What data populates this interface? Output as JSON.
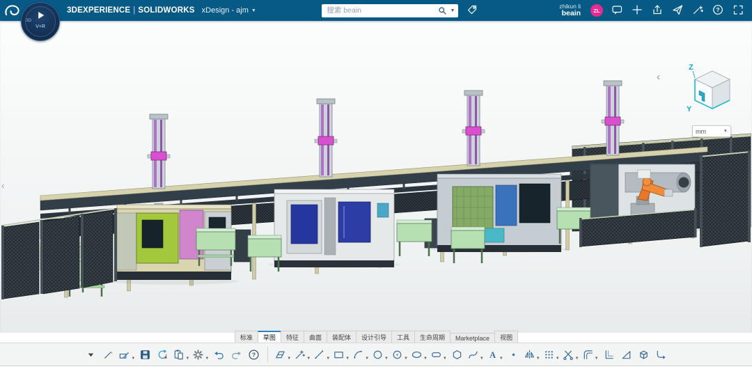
{
  "top_bar": {
    "brand": "3DEXPERIENCE",
    "divider": "|",
    "product": "SOLIDWORKS",
    "app_label": "xDesign - ajm",
    "search": {
      "placeholder": "搜索 beain"
    },
    "user": {
      "name": "zhikun li",
      "space": "beain",
      "avatar": "ZL"
    },
    "icons": [
      "assistant",
      "add",
      "share",
      "send",
      "actions",
      "help",
      "fullscreen"
    ]
  },
  "compass": {
    "quadrant_label": "3D",
    "center_label": "V+R"
  },
  "viewport": {
    "unit_label": "mm",
    "cube_axis_z": "Z",
    "cube_axis_y": "Y"
  },
  "tabs": [
    {
      "label": "标准",
      "active": false
    },
    {
      "label": "草图",
      "active": true
    },
    {
      "label": "特征",
      "active": false
    },
    {
      "label": "曲面",
      "active": false
    },
    {
      "label": "装配体",
      "active": false
    },
    {
      "label": "设计引导",
      "active": false
    },
    {
      "label": "工具",
      "active": false
    },
    {
      "label": "生命周期",
      "active": false
    },
    {
      "label": "Marketplace",
      "active": false
    },
    {
      "label": "视图",
      "active": false
    }
  ],
  "toolbar": {
    "groups": [
      {
        "name": "standard",
        "items": [
          {
            "icon": "caret",
            "name": "overflow-caret",
            "caret": false
          },
          {
            "icon": "sketch",
            "name": "new-sketch",
            "caret": false
          },
          {
            "icon": "sketch-edit",
            "name": "edit-sketch",
            "caret": true
          },
          {
            "icon": "save",
            "name": "save",
            "caret": false
          },
          {
            "icon": "sync",
            "name": "update",
            "caret": false
          },
          {
            "icon": "paste",
            "name": "paste",
            "caret": true
          },
          {
            "icon": "gear",
            "name": "settings",
            "caret": true
          },
          {
            "icon": "undo",
            "name": "undo",
            "caret": false
          },
          {
            "icon": "redo",
            "name": "redo",
            "caret": false
          },
          {
            "icon": "help",
            "name": "help",
            "caret": false
          }
        ]
      },
      {
        "name": "sketch",
        "items": [
          {
            "icon": "plane",
            "name": "sketch-plane",
            "caret": true
          },
          {
            "icon": "instant",
            "name": "instant-sketch",
            "caret": true
          },
          {
            "icon": "line",
            "name": "line-tool",
            "caret": true
          },
          {
            "icon": "rect",
            "name": "rectangle-tool",
            "caret": true
          },
          {
            "icon": "arc",
            "name": "arc-tool",
            "caret": true
          },
          {
            "icon": "circle",
            "name": "circle-tool",
            "caret": true
          },
          {
            "icon": "circle-dot",
            "name": "perimeter-circle",
            "caret": true
          },
          {
            "icon": "ellipse",
            "name": "ellipse-tool",
            "caret": true
          },
          {
            "icon": "slot",
            "name": "slot-tool",
            "caret": true
          },
          {
            "icon": "polygon",
            "name": "polygon-tool",
            "caret": false
          },
          {
            "icon": "spline",
            "name": "spline-tool",
            "caret": true
          },
          {
            "icon": "text",
            "name": "sketch-text",
            "caret": true
          },
          {
            "icon": "point",
            "name": "point-tool",
            "caret": false
          },
          {
            "icon": "mirror",
            "name": "mirror-entities",
            "caret": true
          },
          {
            "icon": "pattern",
            "name": "sketch-pattern",
            "caret": true
          },
          {
            "icon": "trim",
            "name": "trim-entities",
            "caret": true
          },
          {
            "icon": "offset",
            "name": "offset-entities",
            "caret": true
          },
          {
            "icon": "convert",
            "name": "convert-entities",
            "caret": false
          },
          {
            "icon": "triangle",
            "name": "dimension-tool",
            "caret": false
          },
          {
            "icon": "cube",
            "name": "exit-sketch-3d",
            "caret": false
          },
          {
            "icon": "corner",
            "name": "reorient-corner",
            "caret": false
          }
        ]
      }
    ]
  },
  "colors": {
    "topbar_bg": "#075a86",
    "avatar_pink": "#ea2a90",
    "axis_cyan": "#21b6cf",
    "active_tab_blue": "#2d7fc1",
    "gantry_purple": "#b06fc8",
    "carriage_magenta": "#d84fd0",
    "machine_green": "#a4c83c",
    "robot_orange": "#e8772b"
  }
}
